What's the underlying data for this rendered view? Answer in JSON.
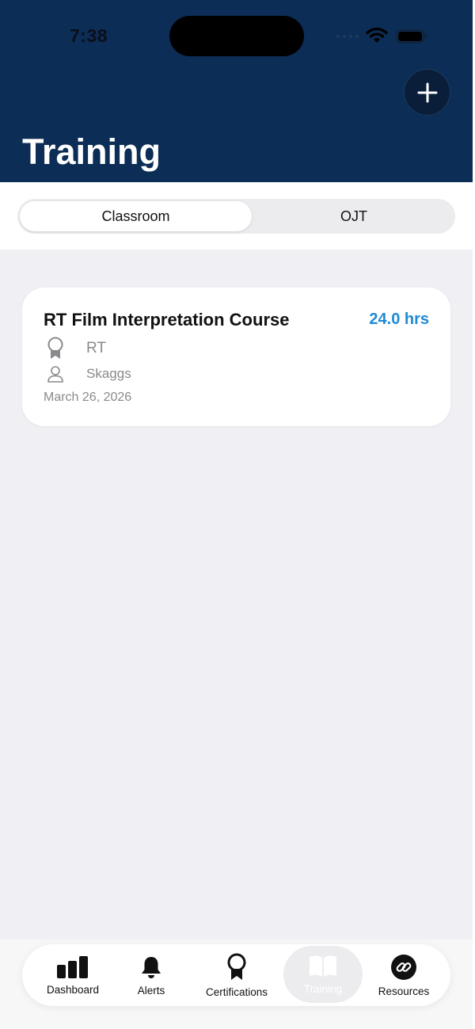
{
  "status_bar": {
    "time": "7:38"
  },
  "header": {
    "title": "Training"
  },
  "segments": {
    "classroom": "Classroom",
    "ojt": "OJT"
  },
  "card": {
    "title": "RT Film Interpretation Course",
    "hours": "24.0 hrs",
    "certification": "RT",
    "instructor": "Skaggs",
    "date": "March 26, 2026"
  },
  "tabs": {
    "dashboard": "Dashboard",
    "alerts": "Alerts",
    "certifications": "Certifications",
    "training": "Training",
    "resources": "Resources"
  },
  "colors": {
    "header_bg": "#0c2d55",
    "accent_blue": "#1f8ad6",
    "content_bg": "#f0f0f4"
  },
  "icons": [
    "add-icon",
    "award-icon",
    "person-icon",
    "bar-chart-icon",
    "bell-icon",
    "book-icon",
    "link-icon",
    "wifi-icon",
    "battery-icon"
  ]
}
